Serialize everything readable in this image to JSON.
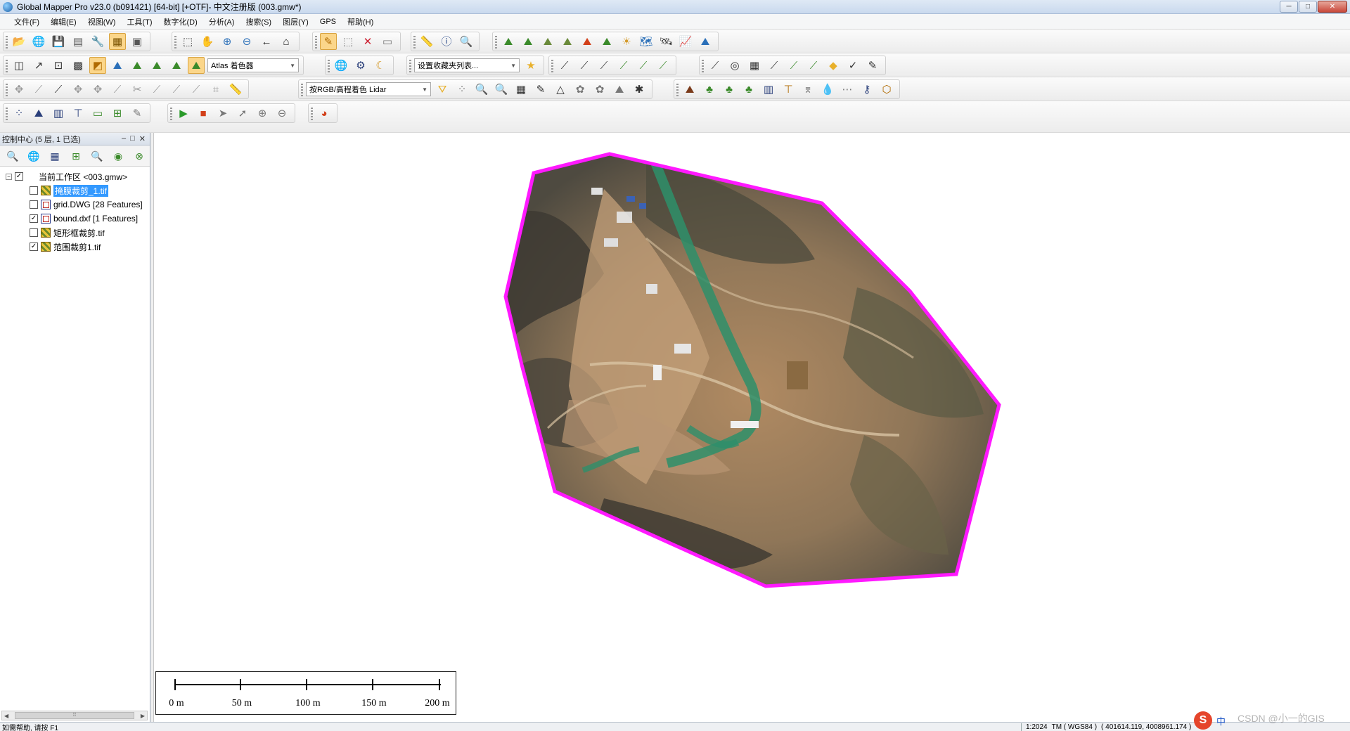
{
  "window": {
    "title": "Global Mapper Pro v23.0 (b091421) [64-bit] [+OTF]- 中文注册版 (003.gmw*)",
    "buttons": {
      "minimize": "─",
      "maximize": "□",
      "close": "✕"
    }
  },
  "menu": [
    "文件(F)",
    "编辑(E)",
    "视图(W)",
    "工具(T)",
    "数字化(D)",
    "分析(A)",
    "搜索(S)",
    "图层(Y)",
    "GPS",
    "帮助(H)"
  ],
  "toolbars": {
    "shader_select": "Atlas 着色器",
    "favorites_select": "设置收藏夹列表...",
    "lidar_select": "按RGB/高程着色 Lidar"
  },
  "control_center": {
    "title": "控制中心 (5 层, 1 已选)",
    "buttons": {
      "minimize": "‒",
      "float": "□",
      "close": "✕"
    },
    "workspace": {
      "label": "当前工作区 <003.gmw>",
      "checked": true
    },
    "layers": [
      {
        "label": "掩膜裁剪_1.tif",
        "checked": false,
        "selected": true,
        "kind": "raster"
      },
      {
        "label": "grid.DWG [28 Features]",
        "checked": false,
        "selected": false,
        "kind": "vector"
      },
      {
        "label": "bound.dxf [1 Features]",
        "checked": true,
        "selected": false,
        "kind": "vector"
      },
      {
        "label": "矩形框裁剪.tif",
        "checked": false,
        "selected": false,
        "kind": "raster"
      },
      {
        "label": "范围裁剪1.tif",
        "checked": true,
        "selected": false,
        "kind": "raster"
      }
    ]
  },
  "map": {
    "boundary_color": "#ff19ff",
    "scale_bar": {
      "labels": [
        "0 m",
        "50 m",
        "100 m",
        "150 m",
        "200 m"
      ]
    }
  },
  "status": {
    "help": "如需帮助, 请按 F1",
    "scale": "1:2024",
    "projection": "TM ( WGS84 )",
    "coords": "( 401614.119, 4008961.174 )"
  },
  "ime": {
    "logo": "S",
    "mode": "中"
  },
  "watermark": "CSDN @小一的GIS"
}
